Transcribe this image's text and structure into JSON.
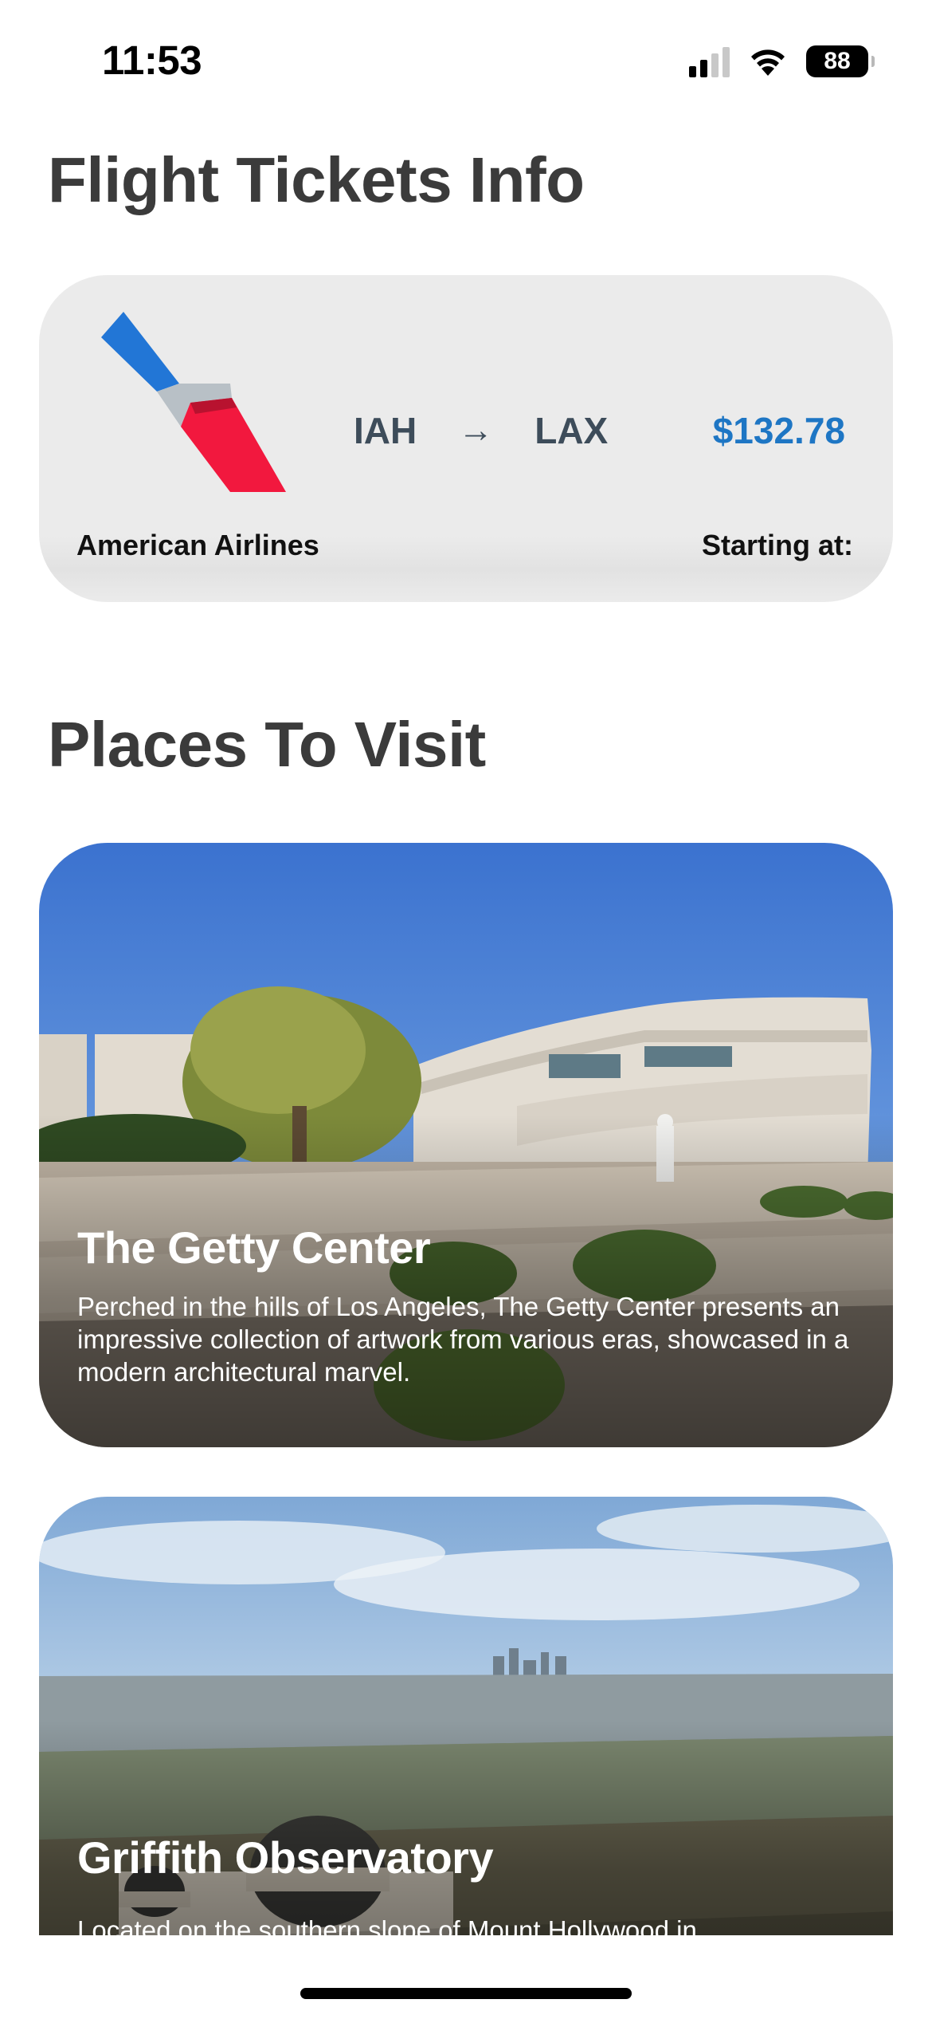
{
  "status_bar": {
    "time": "11:53",
    "battery": "88"
  },
  "flights": {
    "title": "Flight Tickets Info",
    "ticket": {
      "airline": "American Airlines",
      "from": "IAH",
      "arrow": "→",
      "to": "LAX",
      "price_label": "Starting at:",
      "price": "$132.78",
      "price_color": "#1e76c4"
    }
  },
  "places": {
    "title": "Places To Visit",
    "items": [
      {
        "name": "The Getty Center",
        "description": "Perched in the hills of Los Angeles, The Getty Center presents an impressive collection of artwork from various eras, showcased in a modern architectural marvel."
      },
      {
        "name": "Griffith Observatory",
        "description": "Located on the southern slope of Mount Hollywood in"
      }
    ]
  },
  "colors": {
    "heading": "#3b3b3b",
    "card_background": "#ebebeb",
    "route_text": "#3d4c5a"
  }
}
